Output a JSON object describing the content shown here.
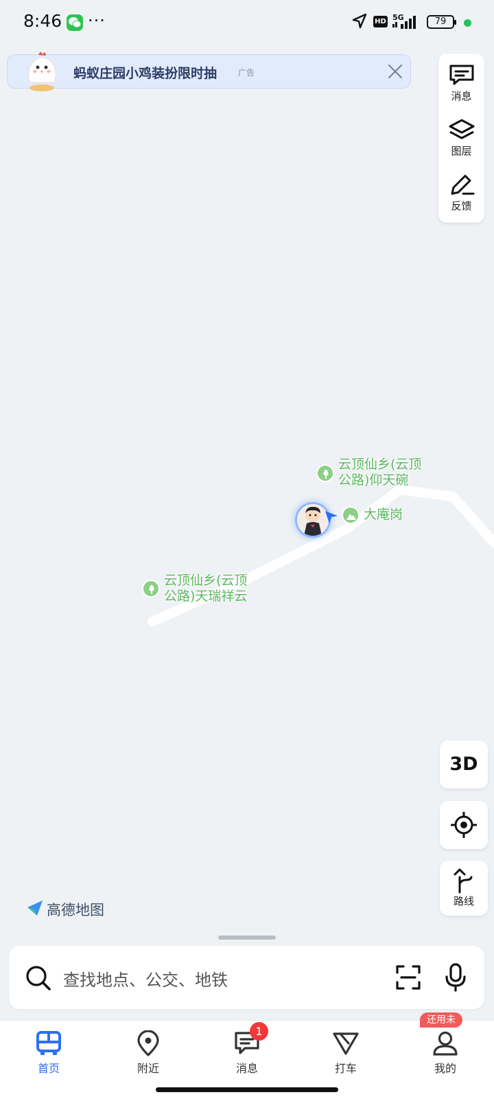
{
  "status_bar": {
    "time": "8:46",
    "dots": "···",
    "network": "HD",
    "signal": "5G",
    "battery": "79",
    "icons": [
      "wechat-icon",
      "navigation-arrow-icon",
      "signal-bars-icon",
      "battery-icon"
    ]
  },
  "ad": {
    "text": "蚂蚁庄园小鸡装扮限时抽",
    "tag": "广告"
  },
  "tools": {
    "messages": "消息",
    "layers": "图层",
    "feedback": "反馈"
  },
  "map": {
    "pois": [
      {
        "line1": "云顶仙乡(云顶",
        "line2": "公路)仰天碗",
        "type": "park"
      },
      {
        "line1": "大庵岗",
        "line2": "",
        "type": "mountain"
      },
      {
        "line1": "云顶仙乡(云顶",
        "line2": "公路)天瑞祥云",
        "type": "park"
      }
    ],
    "logo": "高德地图"
  },
  "controls": {
    "three_d": "3D",
    "route": "路线"
  },
  "search": {
    "placeholder": "查找地点、公交、地铁"
  },
  "nav": {
    "items": [
      {
        "label": "首页",
        "icon": "bus-icon",
        "active": true
      },
      {
        "label": "附近",
        "icon": "location-pin-icon"
      },
      {
        "label": "消息",
        "icon": "message-icon",
        "badge": "1"
      },
      {
        "label": "打车",
        "icon": "taxi-icon"
      },
      {
        "label": "我的",
        "icon": "profile-icon"
      }
    ],
    "promo": "还用未"
  },
  "colors": {
    "accent": "#2d6ff5",
    "poi_green": "#5cb860",
    "badge_red": "#f0393b",
    "map_bg": "#eff2f5"
  }
}
